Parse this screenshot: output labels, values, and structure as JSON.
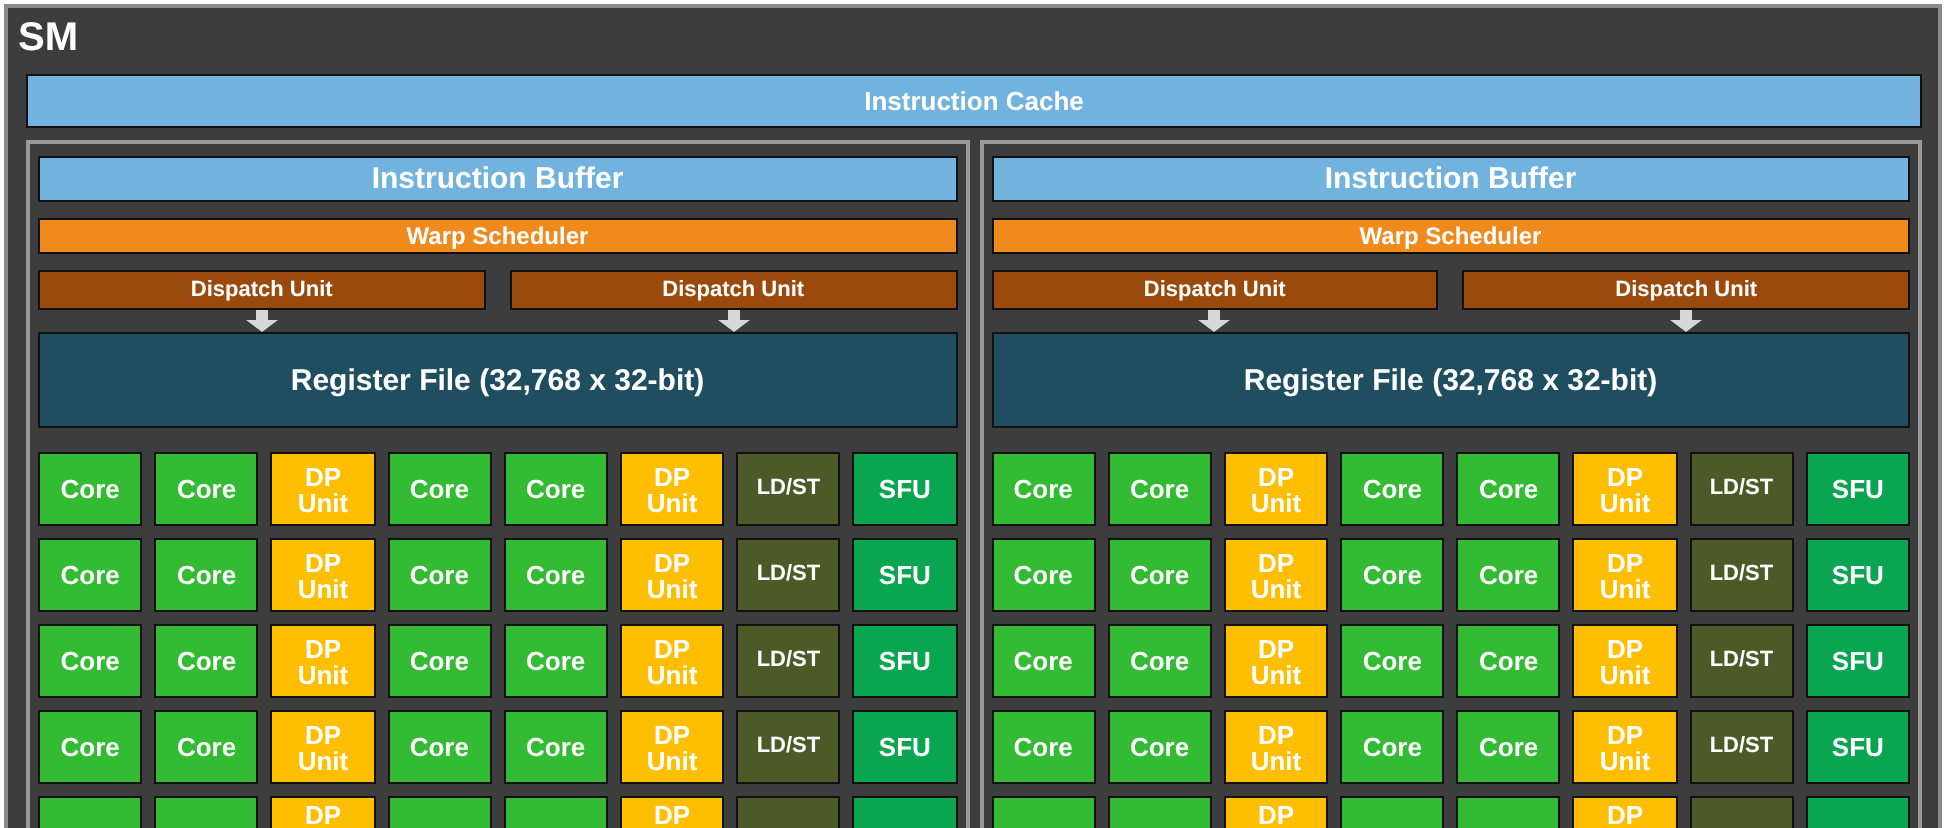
{
  "title": "SM",
  "instruction_cache": "Instruction Cache",
  "partitions": [
    {
      "instruction_buffer": "Instruction Buffer",
      "warp_scheduler": "Warp Scheduler",
      "dispatch_units": [
        "Dispatch Unit",
        "Dispatch Unit"
      ],
      "register_file": "Register File (32,768 x 32-bit)",
      "rows": [
        [
          {
            "kind": "core",
            "label": "Core"
          },
          {
            "kind": "core",
            "label": "Core"
          },
          {
            "kind": "dp",
            "label": "DP\nUnit"
          },
          {
            "kind": "core",
            "label": "Core"
          },
          {
            "kind": "core",
            "label": "Core"
          },
          {
            "kind": "dp",
            "label": "DP\nUnit"
          },
          {
            "kind": "ldst",
            "label": "LD/ST"
          },
          {
            "kind": "sfu",
            "label": "SFU"
          }
        ],
        [
          {
            "kind": "core",
            "label": "Core"
          },
          {
            "kind": "core",
            "label": "Core"
          },
          {
            "kind": "dp",
            "label": "DP\nUnit"
          },
          {
            "kind": "core",
            "label": "Core"
          },
          {
            "kind": "core",
            "label": "Core"
          },
          {
            "kind": "dp",
            "label": "DP\nUnit"
          },
          {
            "kind": "ldst",
            "label": "LD/ST"
          },
          {
            "kind": "sfu",
            "label": "SFU"
          }
        ],
        [
          {
            "kind": "core",
            "label": "Core"
          },
          {
            "kind": "core",
            "label": "Core"
          },
          {
            "kind": "dp",
            "label": "DP\nUnit"
          },
          {
            "kind": "core",
            "label": "Core"
          },
          {
            "kind": "core",
            "label": "Core"
          },
          {
            "kind": "dp",
            "label": "DP\nUnit"
          },
          {
            "kind": "ldst",
            "label": "LD/ST"
          },
          {
            "kind": "sfu",
            "label": "SFU"
          }
        ],
        [
          {
            "kind": "core",
            "label": "Core"
          },
          {
            "kind": "core",
            "label": "Core"
          },
          {
            "kind": "dp",
            "label": "DP\nUnit"
          },
          {
            "kind": "core",
            "label": "Core"
          },
          {
            "kind": "core",
            "label": "Core"
          },
          {
            "kind": "dp",
            "label": "DP\nUnit"
          },
          {
            "kind": "ldst",
            "label": "LD/ST"
          },
          {
            "kind": "sfu",
            "label": "SFU"
          }
        ],
        [
          {
            "kind": "core"
          },
          {
            "kind": "core"
          },
          {
            "kind": "dp",
            "label": "DP"
          },
          {
            "kind": "core"
          },
          {
            "kind": "core"
          },
          {
            "kind": "dp",
            "label": "DP"
          },
          {
            "kind": "ldst"
          },
          {
            "kind": "sfu"
          }
        ]
      ]
    },
    {
      "instruction_buffer": "Instruction Buffer",
      "warp_scheduler": "Warp Scheduler",
      "dispatch_units": [
        "Dispatch Unit",
        "Dispatch Unit"
      ],
      "register_file": "Register File (32,768 x 32-bit)",
      "rows": [
        [
          {
            "kind": "core",
            "label": "Core"
          },
          {
            "kind": "core",
            "label": "Core"
          },
          {
            "kind": "dp",
            "label": "DP\nUnit"
          },
          {
            "kind": "core",
            "label": "Core"
          },
          {
            "kind": "core",
            "label": "Core"
          },
          {
            "kind": "dp",
            "label": "DP\nUnit"
          },
          {
            "kind": "ldst",
            "label": "LD/ST"
          },
          {
            "kind": "sfu",
            "label": "SFU"
          }
        ],
        [
          {
            "kind": "core",
            "label": "Core"
          },
          {
            "kind": "core",
            "label": "Core"
          },
          {
            "kind": "dp",
            "label": "DP\nUnit"
          },
          {
            "kind": "core",
            "label": "Core"
          },
          {
            "kind": "core",
            "label": "Core"
          },
          {
            "kind": "dp",
            "label": "DP\nUnit"
          },
          {
            "kind": "ldst",
            "label": "LD/ST"
          },
          {
            "kind": "sfu",
            "label": "SFU"
          }
        ],
        [
          {
            "kind": "core",
            "label": "Core"
          },
          {
            "kind": "core",
            "label": "Core"
          },
          {
            "kind": "dp",
            "label": "DP\nUnit"
          },
          {
            "kind": "core",
            "label": "Core"
          },
          {
            "kind": "core",
            "label": "Core"
          },
          {
            "kind": "dp",
            "label": "DP\nUnit"
          },
          {
            "kind": "ldst",
            "label": "LD/ST"
          },
          {
            "kind": "sfu",
            "label": "SFU"
          }
        ],
        [
          {
            "kind": "core",
            "label": "Core"
          },
          {
            "kind": "core",
            "label": "Core"
          },
          {
            "kind": "dp",
            "label": "DP\nUnit"
          },
          {
            "kind": "core",
            "label": "Core"
          },
          {
            "kind": "core",
            "label": "Core"
          },
          {
            "kind": "dp",
            "label": "DP\nUnit"
          },
          {
            "kind": "ldst",
            "label": "LD/ST"
          },
          {
            "kind": "sfu",
            "label": "SFU"
          }
        ],
        [
          {
            "kind": "core"
          },
          {
            "kind": "core"
          },
          {
            "kind": "dp",
            "label": "DP"
          },
          {
            "kind": "core"
          },
          {
            "kind": "core"
          },
          {
            "kind": "dp",
            "label": "DP"
          },
          {
            "kind": "ldst"
          },
          {
            "kind": "sfu"
          }
        ]
      ]
    }
  ]
}
